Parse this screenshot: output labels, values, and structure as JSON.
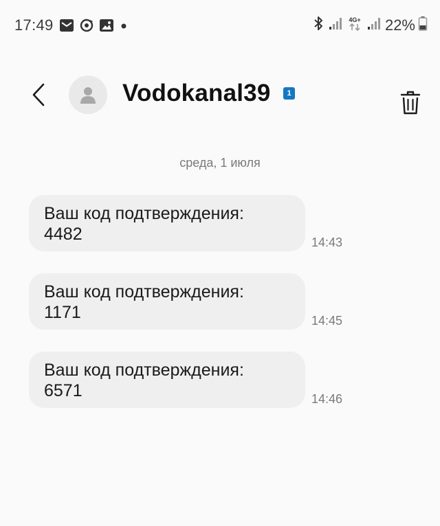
{
  "status_bar": {
    "time": "17:49",
    "left_icons": [
      "gmail-icon",
      "sync-icon",
      "gallery-icon",
      "notification-dot-icon"
    ],
    "right_icons": [
      "bluetooth-icon",
      "signal-icon",
      "network-4g-plus-icon",
      "signal-icon",
      "battery-icon"
    ],
    "network_label": "4G+",
    "battery_percent": "22%"
  },
  "header": {
    "contact_name": "Vodokanal39",
    "sim_badge": "1",
    "back_icon": "back-chevron-icon",
    "avatar_icon": "person-icon",
    "delete_icon": "trash-icon"
  },
  "conversation": {
    "date_separator": "среда, 1 июля",
    "messages": [
      {
        "text": "Ваш код подтверждения:\n4482",
        "time": "14:43"
      },
      {
        "text": "Ваш код подтверждения:\n1171",
        "time": "14:45"
      },
      {
        "text": "Ваш код подтверждения:\n6571",
        "time": "14:46"
      }
    ]
  },
  "colors": {
    "background": "#fafafa",
    "bubble": "#efefef",
    "sim_badge": "#1577c3",
    "secondary_text": "#7a7a7a"
  }
}
